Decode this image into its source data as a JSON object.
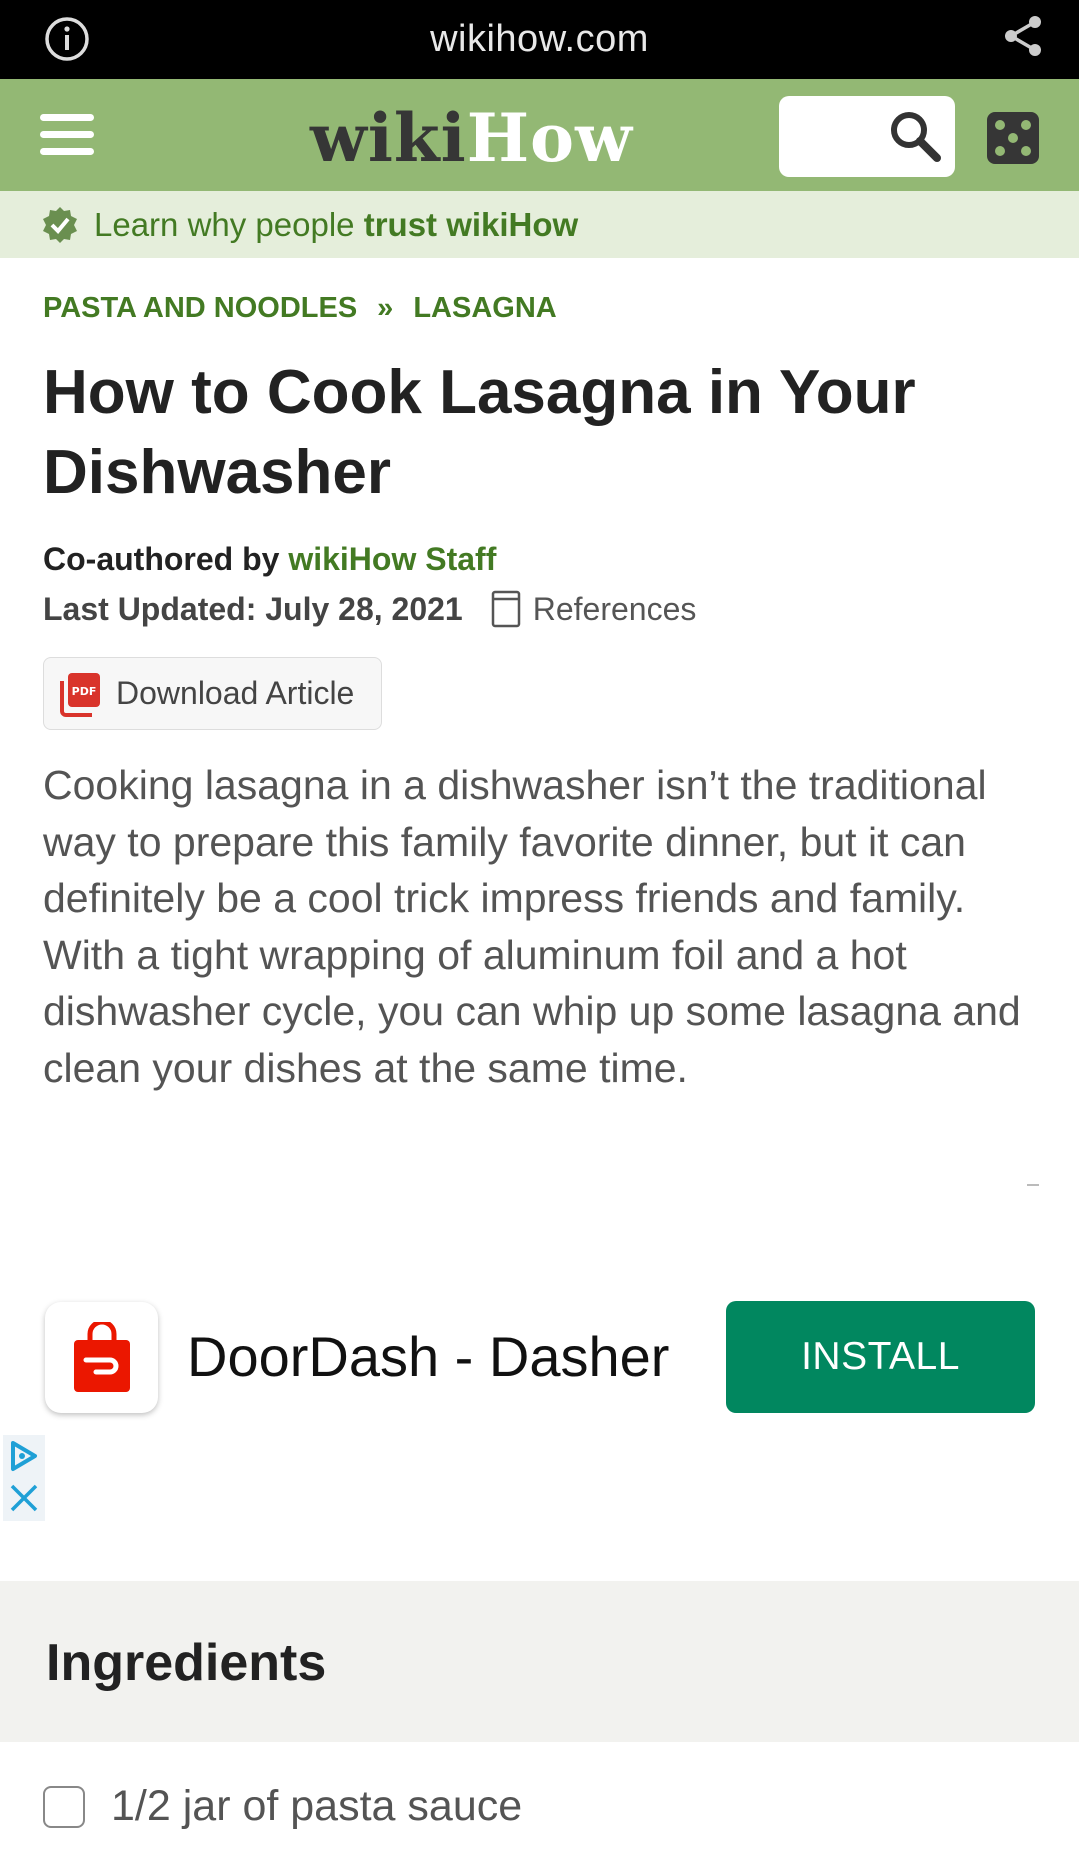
{
  "browser": {
    "url": "wikihow.com"
  },
  "header": {
    "logo_wiki": "wiki",
    "logo_how": "How"
  },
  "trust": {
    "text": "Learn why people ",
    "bold": "trust wikiHow"
  },
  "breadcrumb": {
    "items": [
      "PASTA AND NOODLES",
      "LASAGNA"
    ],
    "separator": "»"
  },
  "article": {
    "title": "How to Cook Lasagna in Your Dishwasher",
    "byline_prefix": "Co-authored by ",
    "author": "wikiHow Staff",
    "updated": "Last Updated: July 28, 2021",
    "references_label": "References",
    "download_label": "Download Article",
    "intro": "Cooking lasagna in a dishwasher isn’t the traditional way to prepare this family favorite dinner, but it can definitely be a cool trick impress friends and family. With a tight wrapping of aluminum foil and a hot dishwasher cycle, you can whip up some lasagna and clean your dishes at the same time."
  },
  "ad": {
    "app_name": "DoorDash - Dasher",
    "install_label": "INSTALL",
    "install_color": "#01875f",
    "brand_color": "#eb1700"
  },
  "ingredients": {
    "heading": "Ingredients",
    "items": [
      "1/2 jar of pasta sauce"
    ]
  },
  "colors": {
    "wikihow_green": "#93b874",
    "link_green": "#437a23"
  },
  "icons": [
    "info-icon",
    "share-icon",
    "menu-icon",
    "search-icon",
    "random-icon",
    "verified-badge-icon",
    "book-icon",
    "pdf-icon",
    "adchoices-icon",
    "close-icon"
  ]
}
